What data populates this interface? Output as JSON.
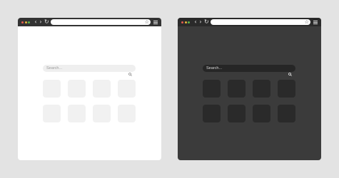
{
  "browsers": [
    {
      "theme": "light",
      "toolbar": {
        "back_icon": "chevron-left-icon",
        "forward_icon": "chevron-right-icon",
        "reload_icon": "reload-icon",
        "bookmark_icon": "star-icon",
        "menu_icon": "hamburger-menu-icon",
        "url_value": ""
      },
      "search": {
        "placeholder": "Search...",
        "icon": "search-icon"
      },
      "shortcut_tiles": 8,
      "colors": {
        "window": "#ffffff",
        "toolbar": "#333333",
        "tile": "#f1f1f1",
        "search_bg": "#efefef"
      }
    },
    {
      "theme": "dark",
      "toolbar": {
        "back_icon": "chevron-left-icon",
        "forward_icon": "chevron-right-icon",
        "reload_icon": "reload-icon",
        "bookmark_icon": "star-icon",
        "menu_icon": "hamburger-menu-icon",
        "url_value": ""
      },
      "search": {
        "placeholder": "Search...",
        "icon": "search-icon"
      },
      "shortcut_tiles": 8,
      "colors": {
        "window": "#3b3b3b",
        "toolbar": "#2a2a2a",
        "tile": "#2a2a2a",
        "search_bg": "#262626"
      }
    }
  ],
  "traffic_lights": {
    "close": "#e35d4f",
    "minimize": "#e8b43a",
    "maximize": "#5ab54b"
  }
}
